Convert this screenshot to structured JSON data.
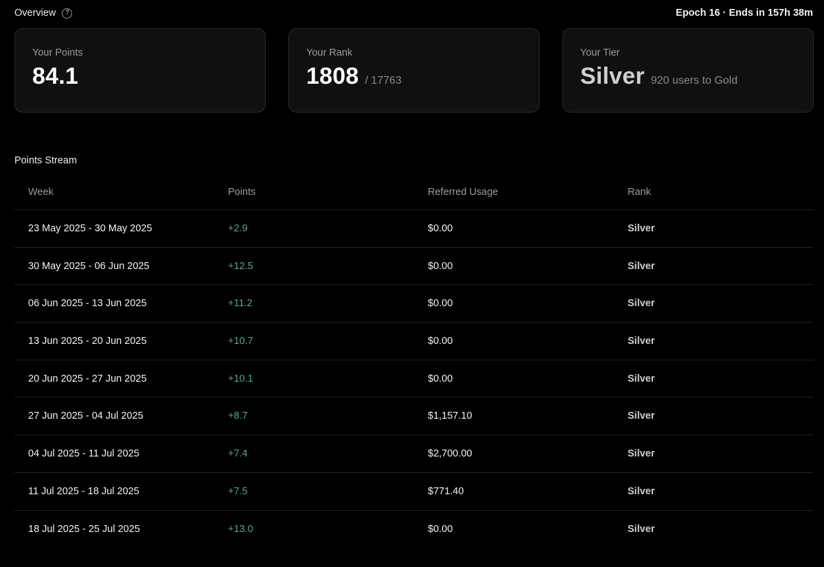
{
  "header": {
    "title": "Overview",
    "epoch_text": "Epoch 16 · Ends in 157h 38m"
  },
  "cards": {
    "points": {
      "label": "Your Points",
      "value": "84.1"
    },
    "rank": {
      "label": "Your Rank",
      "value": "1808",
      "total": "/ 17763"
    },
    "tier": {
      "label": "Your Tier",
      "value": "Silver",
      "note": "920 users to Gold"
    }
  },
  "stream": {
    "title": "Points Stream",
    "columns": [
      "Week",
      "Points",
      "Referred Usage",
      "Rank"
    ],
    "rows": [
      {
        "week": "23 May 2025 - 30 May 2025",
        "points": "+2.9",
        "usage": "$0.00",
        "rank": "Silver"
      },
      {
        "week": "30 May 2025 - 06 Jun 2025",
        "points": "+12.5",
        "usage": "$0.00",
        "rank": "Silver"
      },
      {
        "week": "06 Jun 2025 - 13 Jun 2025",
        "points": "+11.2",
        "usage": "$0.00",
        "rank": "Silver"
      },
      {
        "week": "13 Jun 2025 - 20 Jun 2025",
        "points": "+10.7",
        "usage": "$0.00",
        "rank": "Silver"
      },
      {
        "week": "20 Jun 2025 - 27 Jun 2025",
        "points": "+10.1",
        "usage": "$0.00",
        "rank": "Silver"
      },
      {
        "week": "27 Jun 2025 - 04 Jul 2025",
        "points": "+8.7",
        "usage": "$1,157.10",
        "rank": "Silver"
      },
      {
        "week": "04 Jul 2025 - 11 Jul 2025",
        "points": "+7.4",
        "usage": "$2,700.00",
        "rank": "Silver"
      },
      {
        "week": "11 Jul 2025 - 18 Jul 2025",
        "points": "+7.5",
        "usage": "$771.40",
        "rank": "Silver"
      },
      {
        "week": "18 Jul 2025 - 25 Jul 2025",
        "points": "+13.0",
        "usage": "$0.00",
        "rank": "Silver"
      }
    ]
  },
  "icons": {
    "help": "question-circle-icon"
  },
  "colors": {
    "background": "#000000",
    "card_background": "#101010",
    "card_border": "#2b2b2b",
    "positive_points": "#5fa287",
    "muted_text": "#9c9c9c"
  }
}
